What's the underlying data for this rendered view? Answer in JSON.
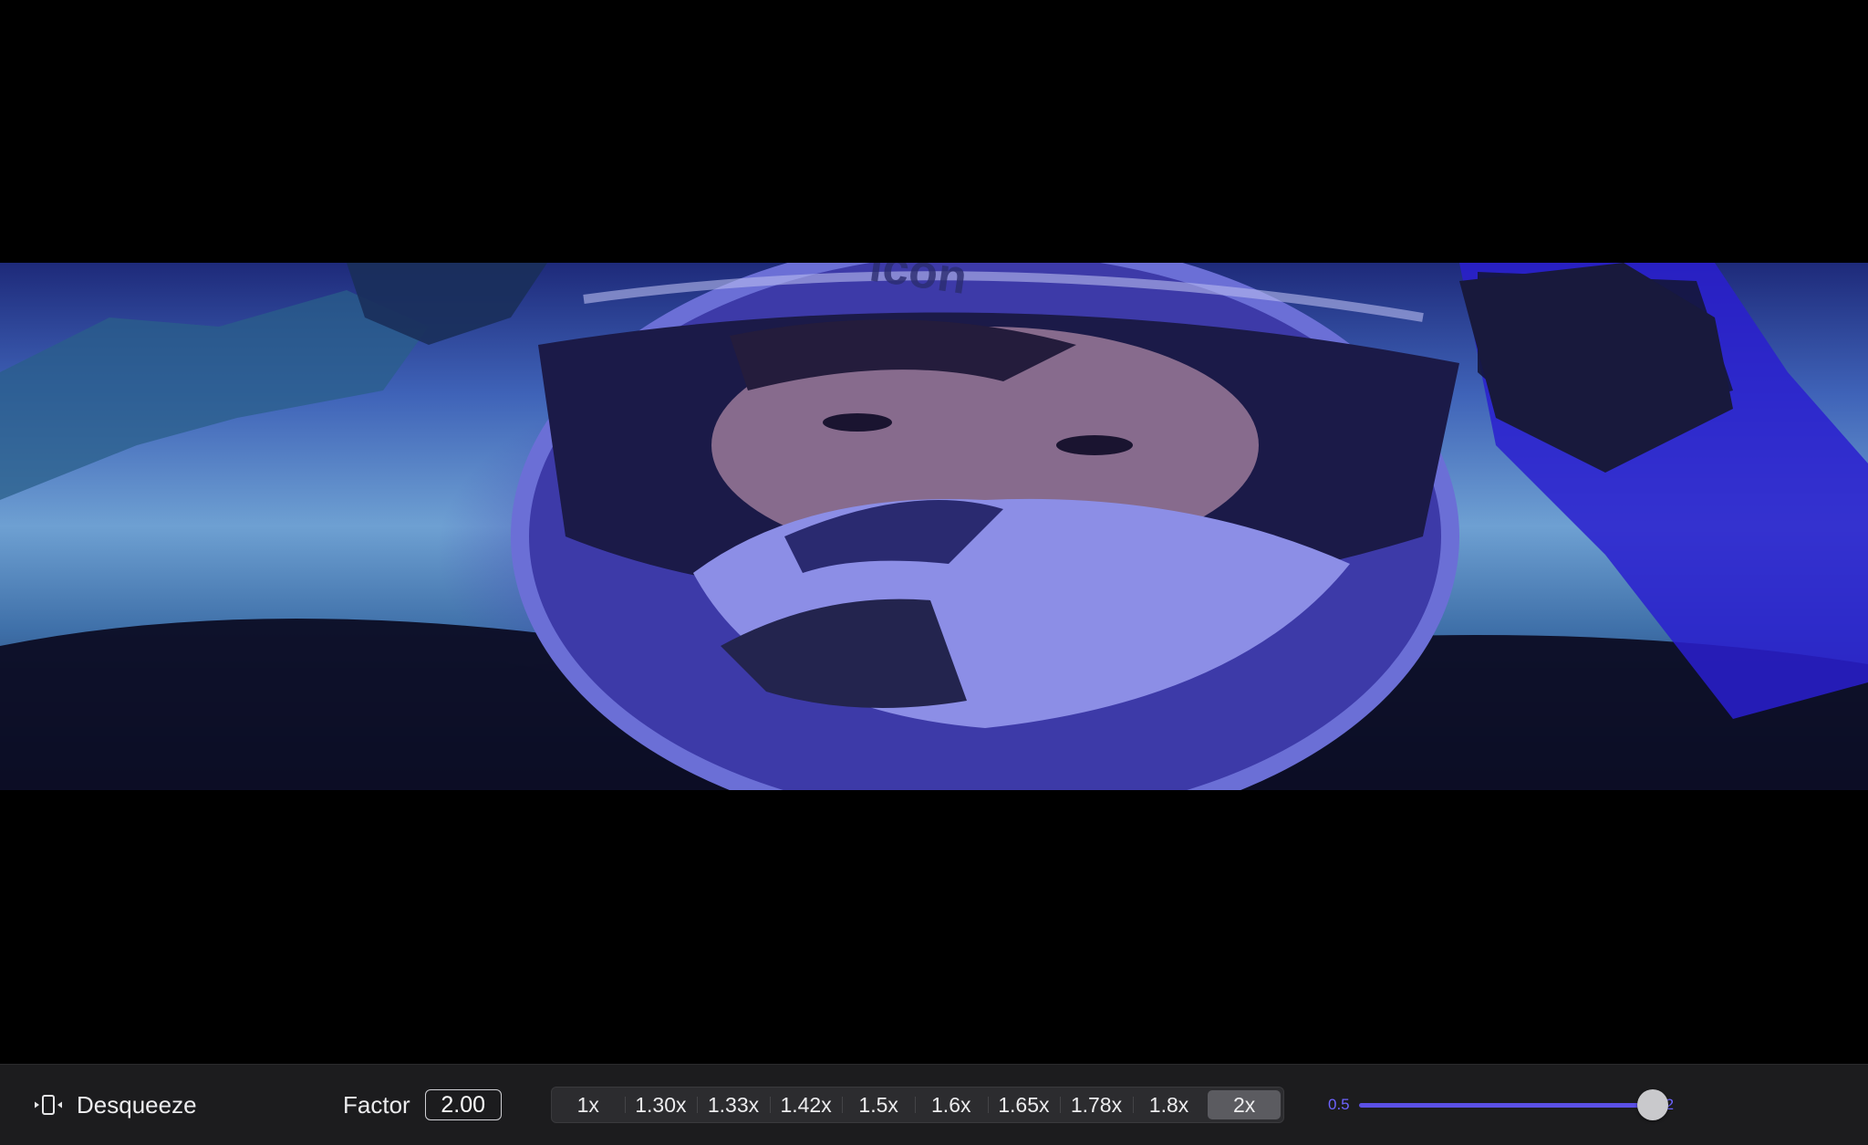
{
  "toolbar": {
    "desqueeze_label": "Desqueeze",
    "desqueeze_icon": "desqueeze-icon",
    "factor_label": "Factor",
    "factor_value": "2.00",
    "presets": [
      "1x",
      "1.30x",
      "1.33x",
      "1.42x",
      "1.5x",
      "1.6x",
      "1.65x",
      "1.78x",
      "1.8x",
      "2x"
    ],
    "active_preset": "2x",
    "slider": {
      "min_label": "0.5",
      "max_label": "2",
      "min": 0.5,
      "max": 2,
      "value": 2,
      "accent": "#5b50e6"
    }
  },
  "viewer": {
    "content": "video-frame"
  }
}
